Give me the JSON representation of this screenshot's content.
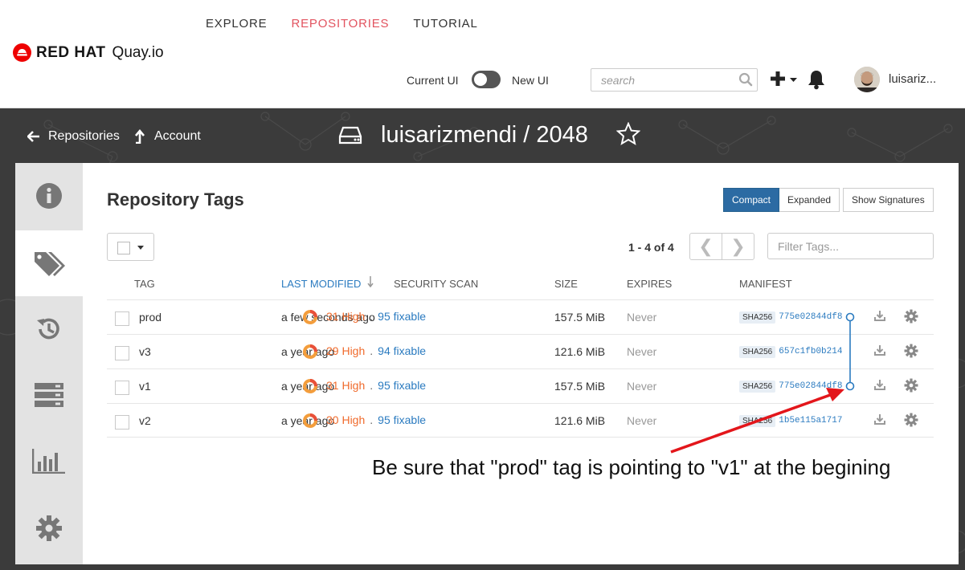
{
  "header": {
    "brand": "RED HAT",
    "product": "Quay.io",
    "nav": [
      {
        "label": "EXPLORE",
        "active": false
      },
      {
        "label": "REPOSITORIES",
        "active": true
      },
      {
        "label": "TUTORIAL",
        "active": false
      }
    ],
    "toggle": {
      "current": "Current UI",
      "new": "New UI"
    },
    "search_placeholder": "search",
    "username": "luisariz..."
  },
  "breadcrumb": {
    "back": "Repositories",
    "account": "Account"
  },
  "repo": {
    "title": "luisarizmendi / 2048"
  },
  "page": {
    "title": "Repository Tags",
    "views": {
      "compact": "Compact",
      "expanded": "Expanded",
      "signatures": "Show Signatures"
    },
    "pager": "1 - 4 of 4",
    "filter_placeholder": "Filter Tags..."
  },
  "table": {
    "columns": [
      "TAG",
      "LAST MODIFIED",
      "SECURITY SCAN",
      "SIZE",
      "EXPIRES",
      "MANIFEST"
    ],
    "rows": [
      {
        "tag": "prod",
        "modified": "a few seconds ago",
        "high": "31 High",
        "fixable": "95 fixable",
        "size": "157.5 MiB",
        "expires": "Never",
        "sha": "SHA256",
        "digest": "775e02844df8"
      },
      {
        "tag": "v3",
        "modified": "a year ago",
        "high": "29 High",
        "fixable": "94 fixable",
        "size": "121.6 MiB",
        "expires": "Never",
        "sha": "SHA256",
        "digest": "657c1fb0b214"
      },
      {
        "tag": "v1",
        "modified": "a year ago",
        "high": "31 High",
        "fixable": "95 fixable",
        "size": "157.5 MiB",
        "expires": "Never",
        "sha": "SHA256",
        "digest": "775e02844df8"
      },
      {
        "tag": "v2",
        "modified": "a year ago",
        "high": "30 High",
        "fixable": "95 fixable",
        "size": "121.6 MiB",
        "expires": "Never",
        "sha": "SHA256",
        "digest": "1b5e115a1717"
      }
    ]
  },
  "annotation": {
    "text": "Be sure that \"prod\" tag is pointing to \"v1\" at the begining",
    "color": "#e3161b"
  },
  "colors": {
    "accent": "#e2535f",
    "primary": "#2c6ba3",
    "link": "#2b7bc0",
    "high": "#f06a2b"
  }
}
